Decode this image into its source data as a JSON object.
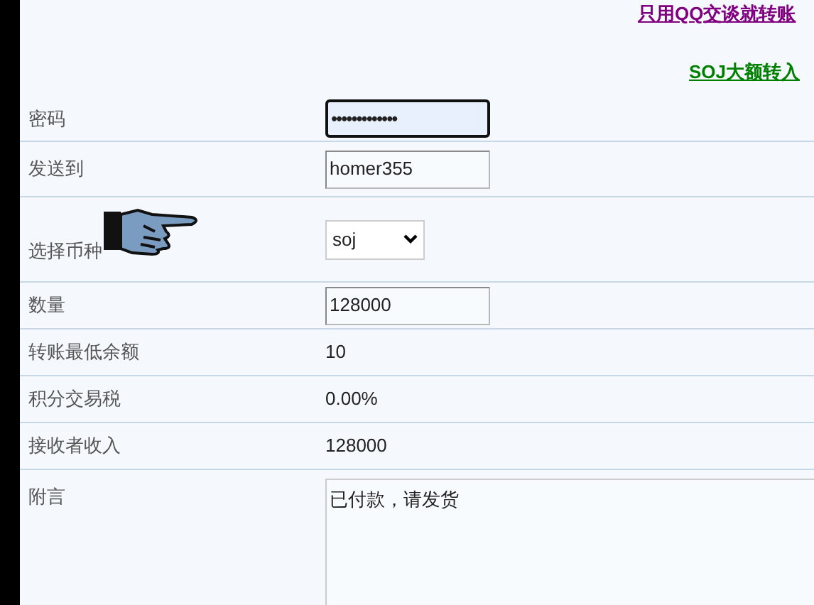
{
  "links": [
    {
      "text": "只用QQ交谈就转账",
      "color": "#800080"
    },
    {
      "text": "SOJ大额转入",
      "color": "#008000"
    }
  ],
  "rows": [
    {
      "label": "密码",
      "kind": "password",
      "value": "•••••••••••••",
      "focused": true
    },
    {
      "label": "发送到",
      "kind": "text",
      "value": "homer355"
    },
    {
      "label": "选择币种",
      "kind": "select",
      "value": "soj",
      "pointer": true
    },
    {
      "label": "数量",
      "kind": "text",
      "value": "128000"
    },
    {
      "label": "转账最低余额",
      "kind": "static",
      "value": "10"
    },
    {
      "label": "积分交易税",
      "kind": "static",
      "value": "0.00%"
    },
    {
      "label": "接收者收入",
      "kind": "static",
      "value": "128000"
    },
    {
      "label": "附言",
      "kind": "textarea",
      "value": "已付款，请发货"
    }
  ]
}
